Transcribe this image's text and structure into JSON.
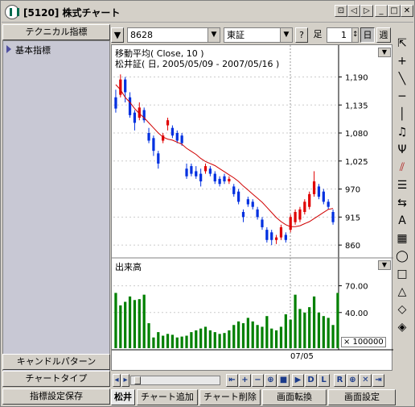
{
  "window": {
    "title": "[5120] 株式チャート",
    "title_buttons": [
      "⊡",
      "◁",
      "▷",
      "_",
      "□",
      "✕"
    ]
  },
  "left_panel": {
    "tab_technical": "テクニカル指標",
    "item_basic": "基本指標",
    "candle_pattern": "キャンドルパターン",
    "chart_type": "チャートタイプ",
    "save_settings": "指標設定保存"
  },
  "toolbar": {
    "code": "8628",
    "market": "東証",
    "help": "?",
    "foot_label": "足",
    "foot_value": "1",
    "day": "日",
    "week": "週"
  },
  "chart": {
    "ma_label": "移動平均( Close, 10 )",
    "stock_label": "松井証( 日, 2005/05/09 - 2007/05/16 )",
    "volume_label": "出来高",
    "volume_scale": "× 100000",
    "x_label": "07/05",
    "price_ticks": [
      "1,190",
      "1,135",
      "1,080",
      "1,025",
      "970",
      "915",
      "860"
    ],
    "volume_ticks": [
      "70.00",
      "40.00"
    ]
  },
  "chart_data": {
    "type": "candlestick",
    "price_ylim": [
      838,
      1205
    ],
    "volume_ylim": [
      0,
      85
    ],
    "candles": [
      {
        "o": 1150,
        "c": 1128,
        "h": 1165,
        "l": 1120
      },
      {
        "o": 1155,
        "c": 1185,
        "h": 1195,
        "l": 1150
      },
      {
        "o": 1185,
        "c": 1160,
        "h": 1190,
        "l": 1140
      },
      {
        "o": 1150,
        "c": 1115,
        "h": 1160,
        "l": 1110
      },
      {
        "o": 1120,
        "c": 1100,
        "h": 1125,
        "l": 1085
      },
      {
        "o": 1110,
        "c": 1130,
        "h": 1140,
        "l": 1105
      },
      {
        "o": 1125,
        "c": 1105,
        "h": 1130,
        "l": 1100
      },
      {
        "o": 1080,
        "c": 1065,
        "h": 1090,
        "l": 1060
      },
      {
        "o": 1070,
        "c": 1045,
        "h": 1075,
        "l": 1035
      },
      {
        "o": 1040,
        "c": 1020,
        "h": 1045,
        "l": 1010
      },
      {
        "o": 1065,
        "c": 1075,
        "h": 1080,
        "l": 1060
      },
      {
        "o": 1095,
        "c": 1105,
        "h": 1110,
        "l": 1085
      },
      {
        "o": 1090,
        "c": 1075,
        "h": 1095,
        "l": 1070
      },
      {
        "o": 1080,
        "c": 1065,
        "h": 1085,
        "l": 1060
      },
      {
        "o": 1075,
        "c": 1060,
        "h": 1080,
        "l": 1055
      },
      {
        "o": 1010,
        "c": 995,
        "h": 1020,
        "l": 990
      },
      {
        "o": 1015,
        "c": 1000,
        "h": 1020,
        "l": 995
      },
      {
        "o": 1005,
        "c": 995,
        "h": 1015,
        "l": 990
      },
      {
        "o": 1000,
        "c": 985,
        "h": 1010,
        "l": 975
      },
      {
        "o": 1005,
        "c": 1015,
        "h": 1020,
        "l": 1000
      },
      {
        "o": 1010,
        "c": 1000,
        "h": 1015,
        "l": 995
      },
      {
        "o": 1000,
        "c": 985,
        "h": 1005,
        "l": 980
      },
      {
        "o": 990,
        "c": 980,
        "h": 995,
        "l": 975
      },
      {
        "o": 995,
        "c": 985,
        "h": 1000,
        "l": 980
      },
      {
        "o": 985,
        "c": 990,
        "h": 995,
        "l": 980
      },
      {
        "o": 975,
        "c": 960,
        "h": 980,
        "l": 955
      },
      {
        "o": 965,
        "c": 945,
        "h": 970,
        "l": 940
      },
      {
        "o": 925,
        "c": 915,
        "h": 930,
        "l": 905
      },
      {
        "o": 950,
        "c": 940,
        "h": 955,
        "l": 935
      },
      {
        "o": 945,
        "c": 935,
        "h": 950,
        "l": 930
      },
      {
        "o": 930,
        "c": 915,
        "h": 935,
        "l": 910
      },
      {
        "o": 910,
        "c": 895,
        "h": 915,
        "l": 890
      },
      {
        "o": 890,
        "c": 870,
        "h": 895,
        "l": 865
      },
      {
        "o": 885,
        "c": 870,
        "h": 890,
        "l": 860
      },
      {
        "o": 870,
        "c": 875,
        "h": 880,
        "l": 862
      },
      {
        "o": 875,
        "c": 895,
        "h": 900,
        "l": 870
      },
      {
        "o": 880,
        "c": 870,
        "h": 885,
        "l": 865
      },
      {
        "o": 890,
        "c": 915,
        "h": 920,
        "l": 885
      },
      {
        "o": 905,
        "c": 925,
        "h": 930,
        "l": 900
      },
      {
        "o": 910,
        "c": 930,
        "h": 935,
        "l": 905
      },
      {
        "o": 925,
        "c": 945,
        "h": 950,
        "l": 920
      },
      {
        "o": 935,
        "c": 960,
        "h": 965,
        "l": 930
      },
      {
        "o": 960,
        "c": 985,
        "h": 1005,
        "l": 955
      },
      {
        "o": 975,
        "c": 955,
        "h": 980,
        "l": 950
      },
      {
        "o": 965,
        "c": 945,
        "h": 970,
        "l": 940
      },
      {
        "o": 945,
        "c": 935,
        "h": 950,
        "l": 930
      },
      {
        "o": 925,
        "c": 905,
        "h": 930,
        "l": 900
      }
    ],
    "ma": [
      1175,
      1165,
      1150,
      1140,
      1128,
      1118,
      1110,
      1100,
      1090,
      1080,
      1072,
      1068,
      1066,
      1062,
      1058,
      1050,
      1044,
      1038,
      1030,
      1024,
      1020,
      1016,
      1010,
      1004,
      998,
      992,
      985,
      976,
      968,
      960,
      952,
      944,
      934,
      924,
      914,
      906,
      900,
      896,
      896,
      898,
      902,
      906,
      912,
      918,
      924,
      930,
      932
    ],
    "volume": [
      62,
      48,
      52,
      58,
      54,
      55,
      60,
      28,
      12,
      18,
      14,
      16,
      15,
      12,
      13,
      14,
      18,
      20,
      22,
      24,
      20,
      18,
      16,
      17,
      20,
      26,
      30,
      28,
      34,
      30,
      26,
      24,
      36,
      22,
      20,
      24,
      38,
      32,
      60,
      44,
      40,
      46,
      58,
      40,
      36,
      34,
      26,
      62
    ]
  },
  "bottom": {
    "matsui": "松井",
    "add_chart": "チャート追加",
    "delete_chart": "チャート削除",
    "switch_screen": "画面転換",
    "screen_settings": "画面設定"
  },
  "colors": {
    "up": "#e00000",
    "down": "#0030e0",
    "ma": "#d00000",
    "volume": "#008000"
  }
}
